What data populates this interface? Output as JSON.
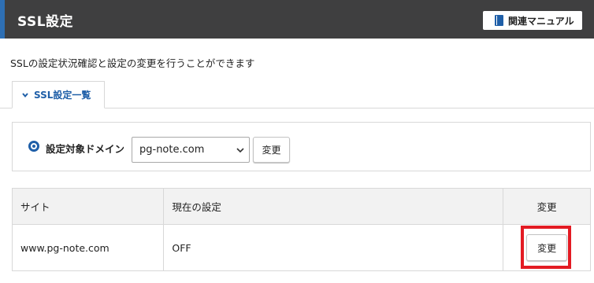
{
  "header": {
    "title": "SSL設定",
    "manual_label": "関連マニュアル",
    "accent": "#2e6fb4"
  },
  "description": "SSLの設定状況確認と設定の変更を行うことができます",
  "tab": {
    "label": "SSL設定一覧"
  },
  "domain": {
    "label": "設定対象ドメイン",
    "selected": "pg-note.com",
    "change_label": "変更"
  },
  "table": {
    "headers": [
      "サイト",
      "現在の設定",
      "変更"
    ],
    "rows": [
      {
        "site": "www.pg-note.com",
        "current": "OFF",
        "change_label": "変更"
      }
    ]
  },
  "highlight_color": "#e31b23"
}
